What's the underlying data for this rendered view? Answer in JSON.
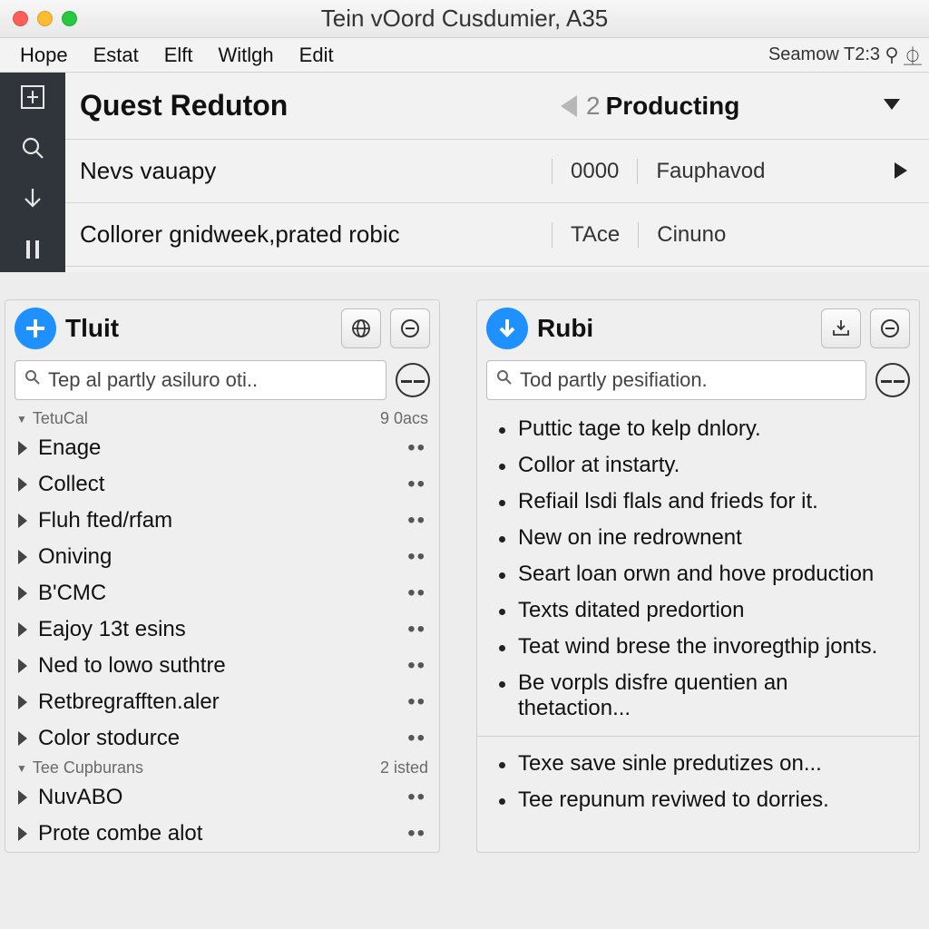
{
  "window": {
    "title": "Tein vOord Cusdumier, A35"
  },
  "menubar": {
    "items": [
      "Hope",
      "Estat",
      "Elft",
      "Witlgh",
      "Edit"
    ],
    "status": "Seamow T2:3"
  },
  "header": {
    "title": "Quest Reduton",
    "selector_count": "2",
    "selector_label": "Producting",
    "rows": [
      {
        "label": "Nevs vauapy",
        "c2": "0000",
        "c3": "Fauphavod"
      },
      {
        "label": "Collorer gnidweek,prated robic",
        "c2": "TAce",
        "c3": "Cinuno"
      }
    ]
  },
  "panel_left": {
    "title": "Tluit",
    "search_placeholder": "Tep al partly asiluro oti..",
    "section1": {
      "label": "TetuCal",
      "count": "9 0acs"
    },
    "items1": [
      "Enage",
      "Collect",
      "Fluh fted/rfam",
      "Oniving",
      "B'CMC",
      "Eajoy 13t esins",
      "Ned to lowo suthtre",
      "Retbregrafften.aler",
      "Color stodurce"
    ],
    "section2": {
      "label": "Tee Cupburans",
      "count": "2 isted"
    },
    "items2": [
      "NuvABO",
      "Prote combe alot"
    ]
  },
  "panel_right": {
    "title": "Rubi",
    "search_placeholder": "Tod partly pesifiation.",
    "bullets1": [
      "Puttic tage to kelp dnlory.",
      "Collor at instarty.",
      "Refiail lsdi flals and frieds for it.",
      "New on ine redrownent",
      "Seart loan orwn and hove production",
      "Texts ditated predortion",
      "Teat wind brese the invoregthip jonts.",
      "Be vorpls disfre quentien an thetaction..."
    ],
    "bullets2": [
      "Texe save sinle predutizes on...",
      "Tee repunum reviwed to dorries."
    ]
  }
}
